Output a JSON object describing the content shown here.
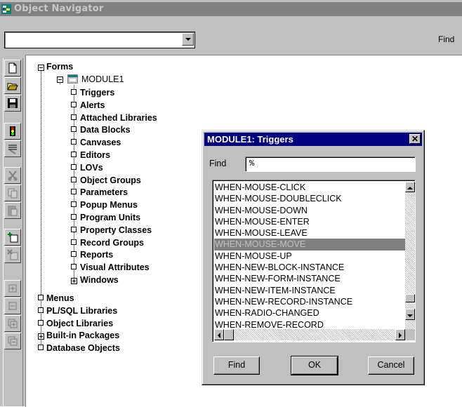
{
  "window": {
    "title": "Object Navigator",
    "icon": "object-navigator-icon"
  },
  "toprow": {
    "combo_value": "",
    "find_label": "Find"
  },
  "toolbar": {
    "buttons": [
      "new-icon",
      "open-icon",
      "save-icon",
      "run-icon",
      "debug-icon",
      "cut-icon",
      "copy-icon",
      "paste-icon",
      "create-icon",
      "delete-icon",
      "expand-icon",
      "collapse-icon",
      "expand-all-icon",
      "collapse-all-icon"
    ]
  },
  "tree": {
    "forms": "Forms",
    "module": "MODULE1",
    "module_children": [
      "Triggers",
      "Alerts",
      "Attached Libraries",
      "Data Blocks",
      "Canvases",
      "Editors",
      "LOVs",
      "Object Groups",
      "Parameters",
      "Popup Menus",
      "Program Units",
      "Property Classes",
      "Record Groups",
      "Reports",
      "Visual Attributes",
      "Windows"
    ],
    "top_level": [
      "Menus",
      "PL/SQL Libraries",
      "Object Libraries",
      "Built-in Packages",
      "Database Objects"
    ]
  },
  "dialog": {
    "title": "MODULE1: Triggers",
    "close": "✕",
    "find_label": "Find",
    "find_value": "%",
    "items": [
      "WHEN-MOUSE-CLICK",
      "WHEN-MOUSE-DOUBLECLICK",
      "WHEN-MOUSE-DOWN",
      "WHEN-MOUSE-ENTER",
      "WHEN-MOUSE-LEAVE",
      "WHEN-MOUSE-MOVE",
      "WHEN-MOUSE-UP",
      "WHEN-NEW-BLOCK-INSTANCE",
      "WHEN-NEW-FORM-INSTANCE",
      "WHEN-NEW-ITEM-INSTANCE",
      "WHEN-NEW-RECORD-INSTANCE",
      "WHEN-RADIO-CHANGED",
      "WHEN-REMOVE-RECORD"
    ],
    "selected_item": "WHEN-MOUSE-MOVE",
    "buttons": {
      "find": "Find",
      "ok": "OK",
      "cancel": "Cancel"
    }
  },
  "colors": {
    "titlebar_inactive": "#808080",
    "dialog_title": "#000080",
    "face": "#c0c0c0",
    "selection": "#808080"
  }
}
